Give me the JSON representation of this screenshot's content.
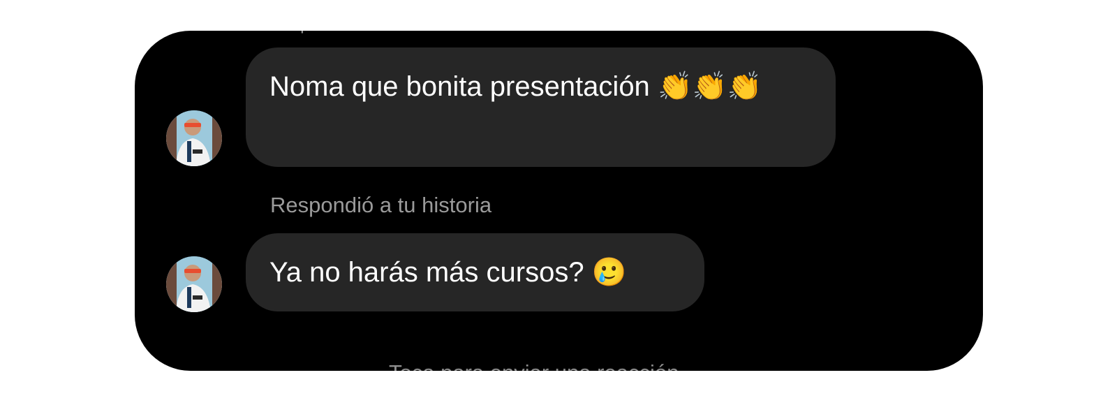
{
  "conversation": {
    "top_partial_text": "p",
    "messages": [
      {
        "text": "Noma que bonita presentación",
        "emoji": "👏👏👏",
        "avatar": "avatar-user"
      },
      {
        "label": "Respondió a tu historia",
        "text": "Ya no harás más cursos?",
        "emoji": "🥲",
        "avatar": "avatar-user"
      }
    ],
    "footer_hint": "Toca para enviar una reacción"
  },
  "colors": {
    "background": "#000000",
    "bubble": "#262626",
    "text": "#ffffff",
    "muted_text": "#9a9a9a"
  }
}
